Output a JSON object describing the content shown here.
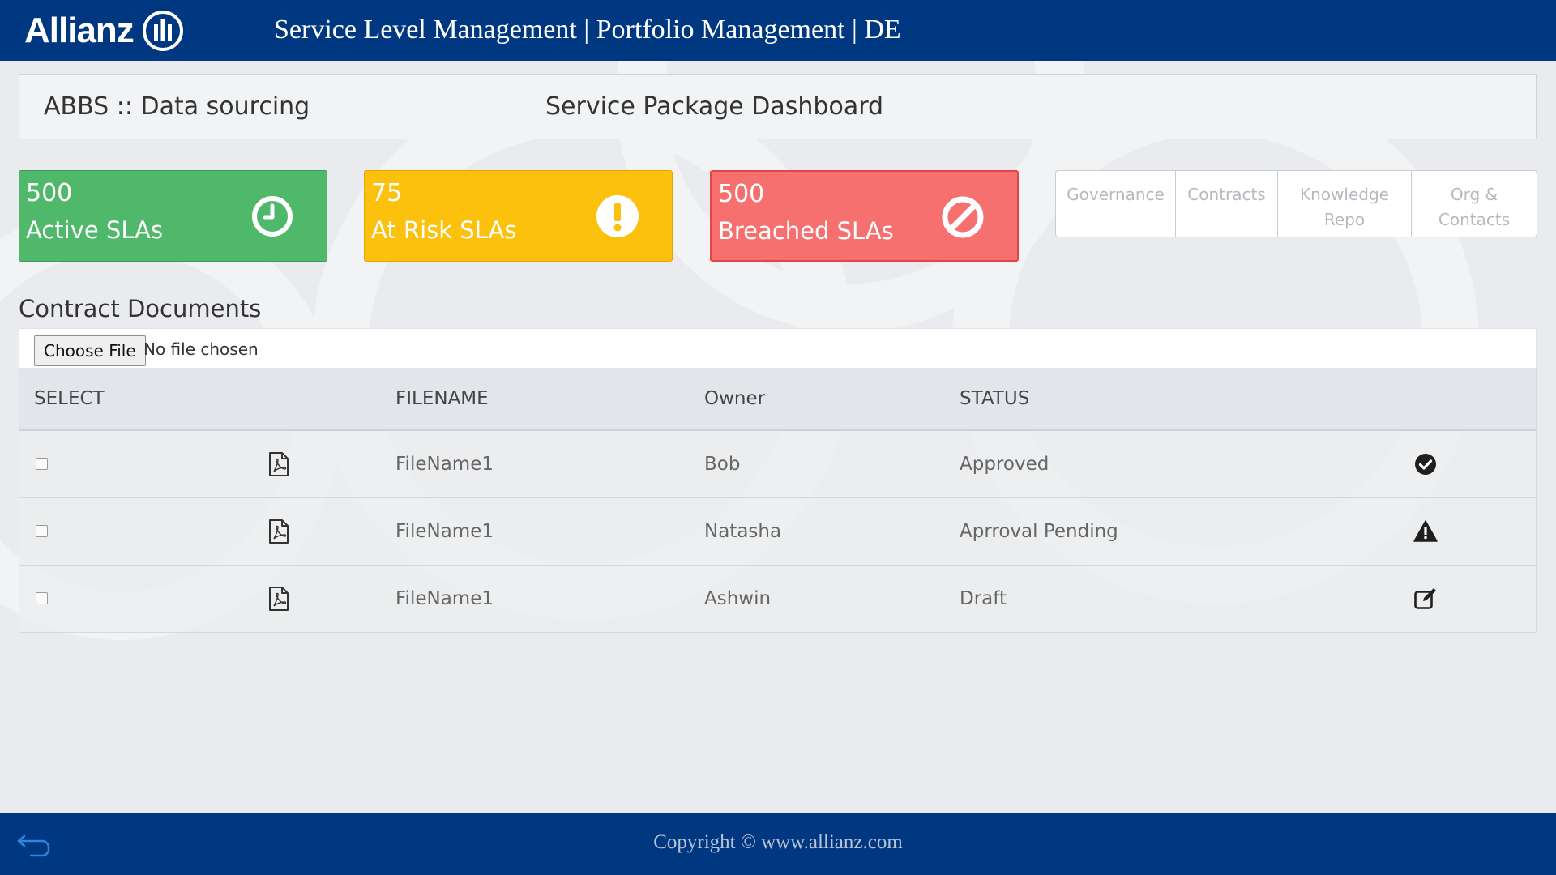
{
  "header": {
    "logo_text": "Allianz",
    "title": "Service Level Management | Portfolio Management | DE",
    "brand_color": "#003781"
  },
  "crumb": {
    "left": "ABBS :: Data sourcing",
    "center": "Service Package Dashboard"
  },
  "kpis": [
    {
      "value": "500",
      "label": "Active SLAs",
      "icon": "clock-icon",
      "color": "#50b86a"
    },
    {
      "value": "75",
      "label": "At Risk SLAs",
      "icon": "exclamation-icon",
      "color": "#fbc10d"
    },
    {
      "value": "500",
      "label": "Breached SLAs",
      "icon": "ban-icon",
      "color": "#f77070"
    }
  ],
  "quicklinks": [
    "Governance",
    "Contracts",
    "Knowledge Repo",
    "Org & Contacts"
  ],
  "documents": {
    "title": "Contract Documents",
    "choose_file": "Choose File",
    "no_file": "No file chosen",
    "columns": [
      "SELECT",
      "FILENAME",
      "Owner",
      "STATUS"
    ],
    "rows": [
      {
        "filename": "FileName1",
        "owner": "Bob",
        "status": "Approved",
        "status_icon": "check-circle-icon"
      },
      {
        "filename": "FileName1",
        "owner": "Natasha",
        "status": "Aprroval Pending",
        "status_icon": "warning-icon"
      },
      {
        "filename": "FileName1",
        "owner": "Ashwin",
        "status": "Draft",
        "status_icon": "edit-icon"
      }
    ]
  },
  "footer": {
    "copyright": "Copyright © www.allianz.com"
  }
}
